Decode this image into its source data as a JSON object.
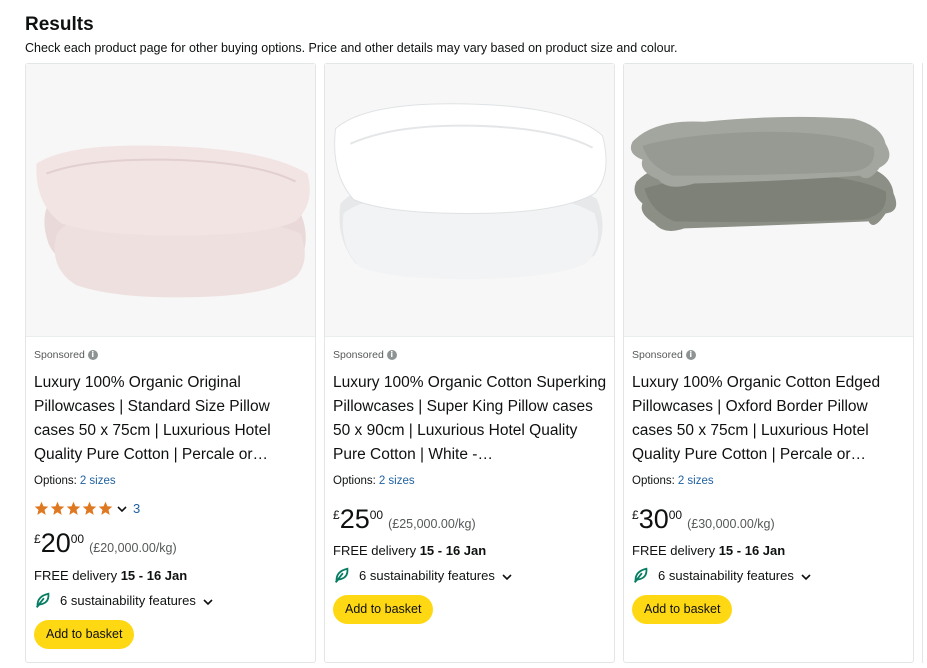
{
  "page": {
    "heading": "Results",
    "subheading": "Check each product page for other buying options. Price and other details may vary based on product size and colour."
  },
  "colors": {
    "accent_button": "#ffd814",
    "link": "#2162a1",
    "star": "#de7921",
    "leaf": "#067d62"
  },
  "products": [
    {
      "sponsored": "Sponsored",
      "title": "Luxury 100% Organic Original Pillowcases | Standard Size Pillow cases 50 x 75cm | Luxurious Hotel Quality Pure Cotton | Percale or…",
      "options_label": "Options:",
      "options_value": "2 sizes",
      "rating": 5,
      "rating_count": "3",
      "price_currency": "£",
      "price_whole": "20",
      "price_fraction": "00",
      "price_per": "(£20,000.00/kg)",
      "delivery_prefix": "FREE delivery",
      "delivery_dates": "15 - 16 Jan",
      "sustainability": "6 sustainability features",
      "button": "Add to basket",
      "image_icon": "pink-pillow-image"
    },
    {
      "sponsored": "Sponsored",
      "title": "Luxury 100% Organic Cotton Superking Pillowcases | Super King Pillow cases 50 x 90cm | Luxurious Hotel Quality Pure Cotton | White -…",
      "options_label": "Options:",
      "options_value": "2 sizes",
      "price_currency": "£",
      "price_whole": "25",
      "price_fraction": "00",
      "price_per": "(£25,000.00/kg)",
      "delivery_prefix": "FREE delivery",
      "delivery_dates": "15 - 16 Jan",
      "sustainability": "6 sustainability features",
      "button": "Add to basket",
      "image_icon": "white-pillow-image"
    },
    {
      "sponsored": "Sponsored",
      "title": "Luxury 100% Organic Cotton Edged Pillowcases | Oxford Border Pillow cases 50 x 75cm | Luxurious Hotel Quality Pure Cotton | Percale or…",
      "options_label": "Options:",
      "options_value": "2 sizes",
      "price_currency": "£",
      "price_whole": "30",
      "price_fraction": "00",
      "price_per": "(£30,000.00/kg)",
      "delivery_prefix": "FREE delivery",
      "delivery_dates": "15 - 16 Jan",
      "sustainability": "6 sustainability features",
      "button": "Add to basket",
      "image_icon": "grey-pillow-image"
    }
  ]
}
